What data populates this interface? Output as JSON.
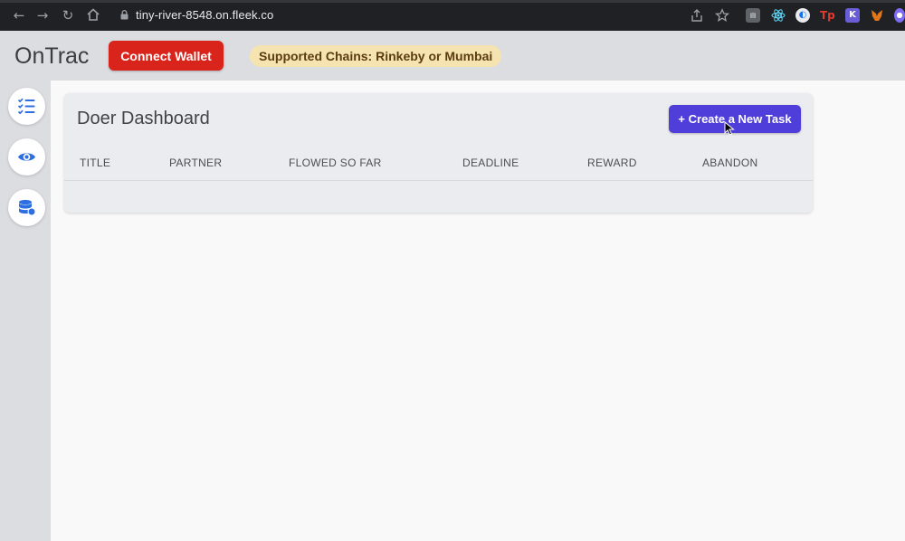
{
  "browser": {
    "url": "tiny-river-8548.on.fleek.co",
    "extensions": [
      "ext-icon-1",
      "react-icon",
      "ext-icon-3",
      "Tp",
      "K",
      "metamask-icon",
      "ext-icon-7"
    ]
  },
  "header": {
    "brand": "OnTrac",
    "connect_label": "Connect Wallet",
    "chains_label": "Supported Chains: Rinkeby or Mumbai"
  },
  "sidebar": {
    "items": [
      {
        "icon": "checklist-icon"
      },
      {
        "icon": "eye-icon"
      },
      {
        "icon": "coins-icon"
      }
    ]
  },
  "dashboard": {
    "title": "Doer Dashboard",
    "create_label": "+ Create a New Task",
    "columns": [
      "TITLE",
      "PARTNER",
      "FLOWED SO FAR",
      "DEADLINE",
      "REWARD",
      "ABANDON"
    ],
    "rows": []
  },
  "colors": {
    "connect": "#d9241b",
    "create": "#4f3ed9",
    "badge_bg": "#f5e4b0",
    "sidebar_icon": "#2d6fe0"
  }
}
